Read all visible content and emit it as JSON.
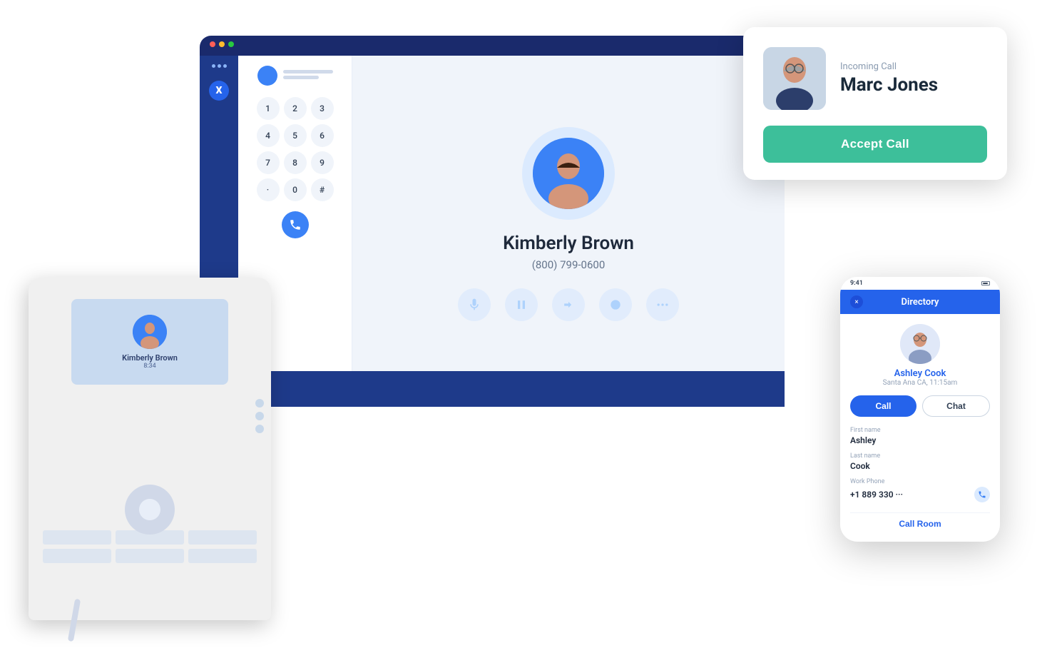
{
  "scene": {
    "background": "#ffffff"
  },
  "incoming_call": {
    "label": "Incoming Call",
    "caller_name": "Marc Jones",
    "accept_btn": "Accept Call"
  },
  "desktop_app": {
    "dialpad": {
      "keys": [
        "1",
        "2",
        "3",
        "4",
        "5",
        "6",
        "7",
        "8",
        "9",
        "·",
        "0",
        "#"
      ]
    },
    "active_call": {
      "contact_name": "Kimberly Brown",
      "phone": "(800) 799-0600"
    }
  },
  "desk_phone": {
    "contact_name": "Kimberly Brown",
    "call_duration": "8:34"
  },
  "mobile_directory": {
    "header_title": "Directory",
    "close_btn": "×",
    "contact": {
      "name": "Ashley Cook",
      "location": "Santa Ana CA, 11:15am"
    },
    "call_btn": "Call",
    "chat_btn": "Chat",
    "first_name_label": "First name",
    "first_name": "Ashley",
    "last_name_label": "Last name",
    "last_name": "Cook",
    "work_phone_label": "Work Phone",
    "work_phone": "+1 889 330 ···",
    "call_room_btn": "Call Room"
  }
}
